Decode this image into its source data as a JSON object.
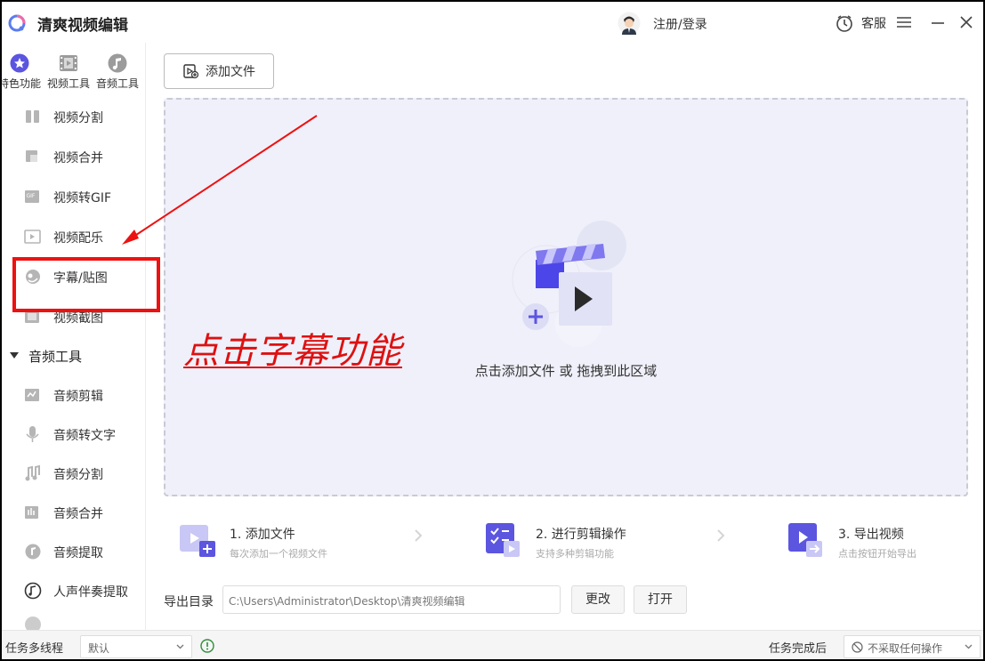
{
  "app": {
    "title": "清爽视频编辑"
  },
  "titlebar": {
    "login": "注册/登录",
    "service": "客服"
  },
  "sidebar": {
    "categories": [
      "特色功能",
      "视频工具",
      "音频工具"
    ],
    "video_items": [
      "视频分割",
      "视频合并",
      "视频转GIF",
      "视频配乐",
      "字幕/贴图",
      "视频截图"
    ],
    "audio_section": "音频工具",
    "audio_items": [
      "音频剪辑",
      "音频转文字",
      "音频分割",
      "音频合并",
      "音频提取",
      "人声伴奏提取"
    ]
  },
  "main": {
    "add_file": "添加文件",
    "dropzone_text": "点击添加文件 或 拖拽到此区域",
    "steps": [
      {
        "title": "1. 添加文件",
        "sub": "每次添加一个视频文件"
      },
      {
        "title": "2. 进行剪辑操作",
        "sub": "支持多种剪辑功能"
      },
      {
        "title": "3. 导出视频",
        "sub": "点击按钮开始导出"
      }
    ],
    "export_label": "导出目录",
    "export_path": "C:\\Users\\Administrator\\Desktop\\清爽视频编辑",
    "change": "更改",
    "open": "打开"
  },
  "statusbar": {
    "thread_label": "任务多线程",
    "thread_value": "默认",
    "after_label": "任务完成后",
    "after_value": "不采取任何操作"
  },
  "annotation": {
    "text": "点击字幕功能"
  },
  "colors": {
    "accent": "#5b55e0",
    "annotation": "#e01111",
    "dropzone_bg": "#eff0fa"
  }
}
